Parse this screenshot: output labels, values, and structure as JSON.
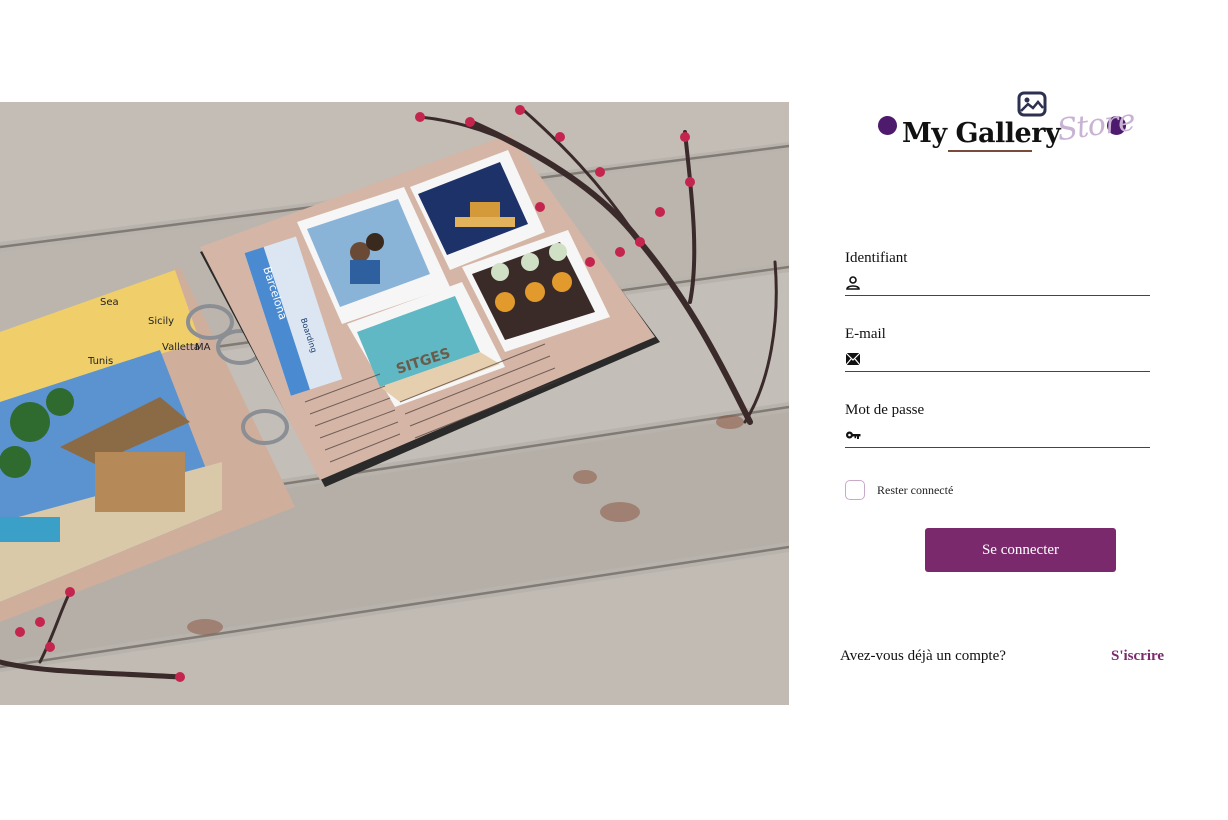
{
  "hero": {
    "map_labels": [
      "Sea",
      "Sicily",
      "Tunis",
      "Valletta",
      "MA"
    ],
    "ticket_text": "Barcelona",
    "ticket_sub": "Boarding",
    "photo_caption": "SITGES"
  },
  "logo": {
    "brand_text": "My Gallery",
    "script_text": "Store",
    "brand_color": "#4e1a6e"
  },
  "form": {
    "username": {
      "label": "Identifiant",
      "value": "",
      "icon": "user-icon"
    },
    "email": {
      "label": "E-mail",
      "value": "",
      "icon": "envelope-icon"
    },
    "password": {
      "label": "Mot de passe",
      "value": "",
      "icon": "key-icon"
    },
    "remember": {
      "label": "Rester connecté",
      "checked": false
    },
    "submit_label": "Se connecter"
  },
  "signup": {
    "question": "Avez-vous déjà un compte?",
    "link_label": "S'iscrire"
  },
  "colors": {
    "accent": "#7a2a6c",
    "underline": "#6b2a6e"
  }
}
